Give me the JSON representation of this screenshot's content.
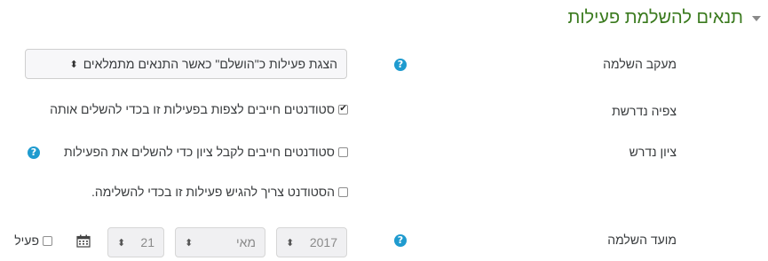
{
  "section": {
    "title": "תנאים להשלמת פעילות"
  },
  "completion_tracking": {
    "label": "מעקב השלמה",
    "select_value": "הצגת פעילות כ\"הושלם\" כאשר התנאים מתמלאים",
    "arrows": "⬍"
  },
  "require_view": {
    "label": "צפיה נדרשת",
    "checkbox_label": "סטודנטים חייבים לצפות בפעילות זו בכדי להשלים אותה",
    "checked": true
  },
  "require_grade": {
    "label": "ציון נדרש",
    "checkbox_label": "סטודנטים חייבים לקבל ציון כדי להשלים את הפעילות",
    "checked": false
  },
  "require_submit": {
    "checkbox_label": "הסטודנט צריך להגיש פעילות זו בכדי להשלימה.",
    "checked": false
  },
  "expected_completion": {
    "label": "מועד השלמה",
    "year": "2017",
    "month": "מאי",
    "day": "21",
    "enable_label": "פעיל",
    "enabled": false
  },
  "icons": {
    "help": "?",
    "check": "✔",
    "arrows": "⬍",
    "calendar": "calendar-icon"
  },
  "colors": {
    "section_title": "#3a7a1e",
    "help_icon": "#1f9bcf",
    "text": "#373a3c"
  }
}
